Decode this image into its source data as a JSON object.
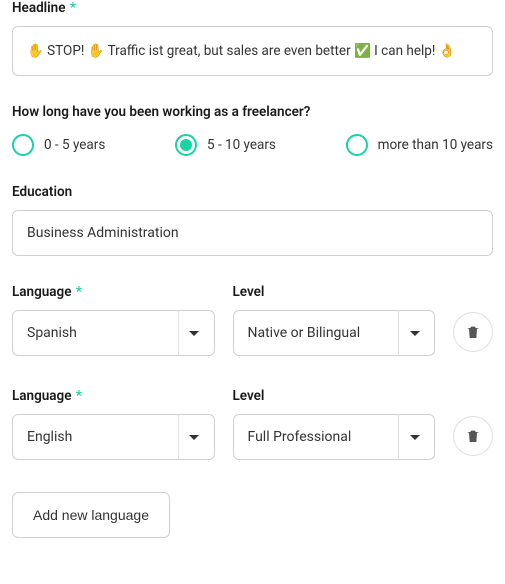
{
  "headline": {
    "label": "Headline",
    "required": true,
    "value": "✋ STOP! ✋ Traffic ist great, but sales are even better ✅ I can help! 👌"
  },
  "freelancer_duration": {
    "label": "How long have you been working as a freelancer?",
    "options": [
      {
        "label": "0 - 5 years",
        "selected": false
      },
      {
        "label": "5 - 10 years",
        "selected": true
      },
      {
        "label": "more than 10 years",
        "selected": false
      }
    ]
  },
  "education": {
    "label": "Education",
    "value": "Business Administration"
  },
  "language_label": "Language",
  "level_label": "Level",
  "languages": [
    {
      "lang": "Spanish",
      "level": "Native or Bilingual"
    },
    {
      "lang": "English",
      "level": "Full Professional"
    }
  ],
  "add_language_label": "Add new language",
  "asterisk": "*"
}
